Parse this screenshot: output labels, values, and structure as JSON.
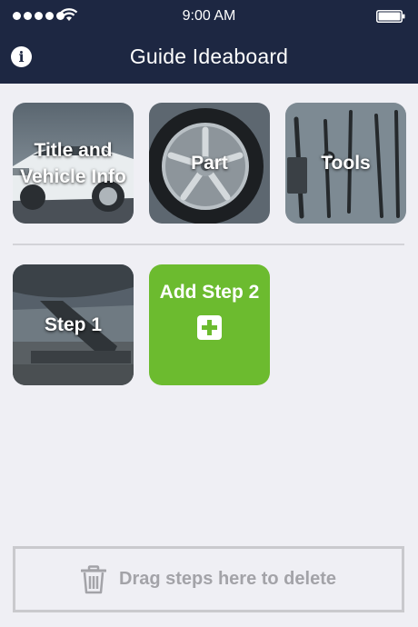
{
  "status_bar": {
    "time": "9:00 AM"
  },
  "nav": {
    "title": "Guide Ideaboard"
  },
  "tiles": [
    {
      "label": "Title and Vehicle Info"
    },
    {
      "label": "Part"
    },
    {
      "label": "Tools"
    }
  ],
  "steps": [
    {
      "label": "Step 1"
    }
  ],
  "add_step": {
    "label": "Add Step 2"
  },
  "trash": {
    "label": "Drag steps here to delete"
  },
  "colors": {
    "nav_bg": "#1d2742",
    "accent_green": "#6cbb2f",
    "page_bg": "#efeff4"
  }
}
